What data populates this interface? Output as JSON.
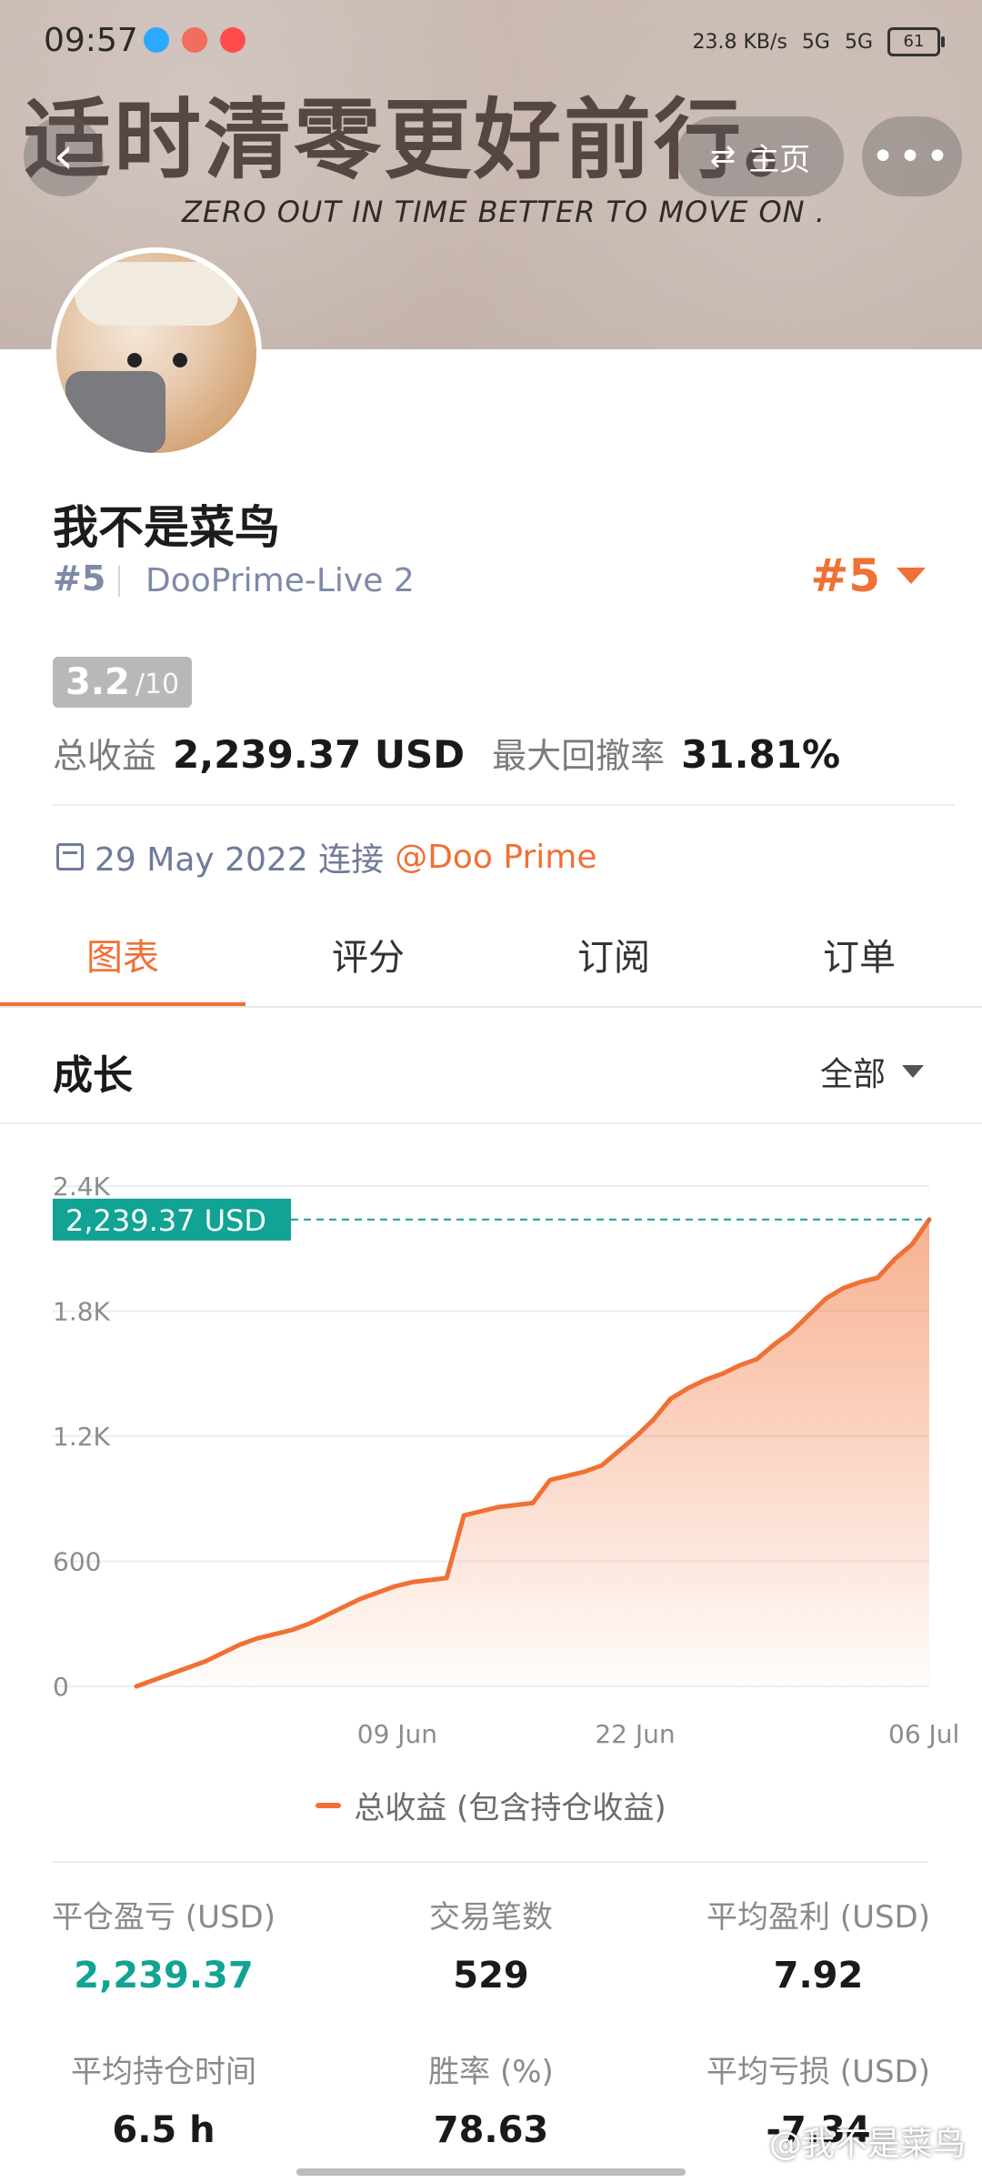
{
  "status": {
    "time": "09:57",
    "network_speed": "23.8 KB/s",
    "signal_1": "5G",
    "signal_2": "5G",
    "battery": "61"
  },
  "banner": {
    "main_text": "适时清零更好前行。",
    "sub_text": "ZERO OUT IN TIME BETTER TO MOVE ON ."
  },
  "nav": {
    "home_label": "主页",
    "more_label": "•••"
  },
  "profile": {
    "name": "我不是菜鸟",
    "rank_left": "#5",
    "server": "DooPrime-Live 2",
    "rank_right": "#5",
    "score": "3.2",
    "score_max": "/10",
    "total_profit_label": "总收益",
    "total_profit_value": "2,239.37 USD",
    "max_drawdown_label": "最大回撤率",
    "max_drawdown_value": "31.81%",
    "connected_date": "29 May 2022 连接",
    "broker": "@Doo Prime"
  },
  "tabs": [
    "图表",
    "评分",
    "订阅",
    "订单"
  ],
  "growth": {
    "title": "成长",
    "filter": "全部",
    "legend": "总收益 (包含持仓收益)"
  },
  "chart_data": {
    "type": "area",
    "title": "",
    "xlabel": "",
    "ylabel": "",
    "y_ticks": [
      "2.4K",
      "1.8K",
      "1.2K",
      "600",
      "0"
    ],
    "x_ticks": [
      "09 Jun",
      "22 Jun",
      "06 Jul"
    ],
    "ylim": [
      0,
      2400
    ],
    "current_label": "2,239.37 USD",
    "current_value": 2239.37,
    "series": [
      {
        "name": "总收益 (包含持仓收益)",
        "color": "#f07035",
        "values": [
          0,
          30,
          60,
          90,
          120,
          160,
          200,
          230,
          250,
          270,
          300,
          340,
          380,
          420,
          450,
          480,
          500,
          510,
          520,
          820,
          840,
          860,
          870,
          880,
          990,
          1010,
          1030,
          1060,
          1130,
          1200,
          1280,
          1380,
          1430,
          1470,
          1500,
          1540,
          1570,
          1640,
          1700,
          1780,
          1860,
          1910,
          1940,
          1960,
          2050,
          2120,
          2239.37
        ]
      }
    ]
  },
  "metrics": [
    {
      "label": "平仓盈亏 (USD)",
      "value": "2,239.37",
      "color": "green"
    },
    {
      "label": "交易笔数",
      "value": "529",
      "color": "default"
    },
    {
      "label": "平均盈利 (USD)",
      "value": "7.92",
      "color": "default"
    },
    {
      "label": "平均持仓时间",
      "value": "6.5 h",
      "color": "default"
    },
    {
      "label": "胜率 (%)",
      "value": "78.63",
      "color": "default"
    },
    {
      "label": "平均亏损 (USD)",
      "value": "-7.34",
      "color": "default"
    }
  ],
  "watermark": "@我不是菜鸟"
}
